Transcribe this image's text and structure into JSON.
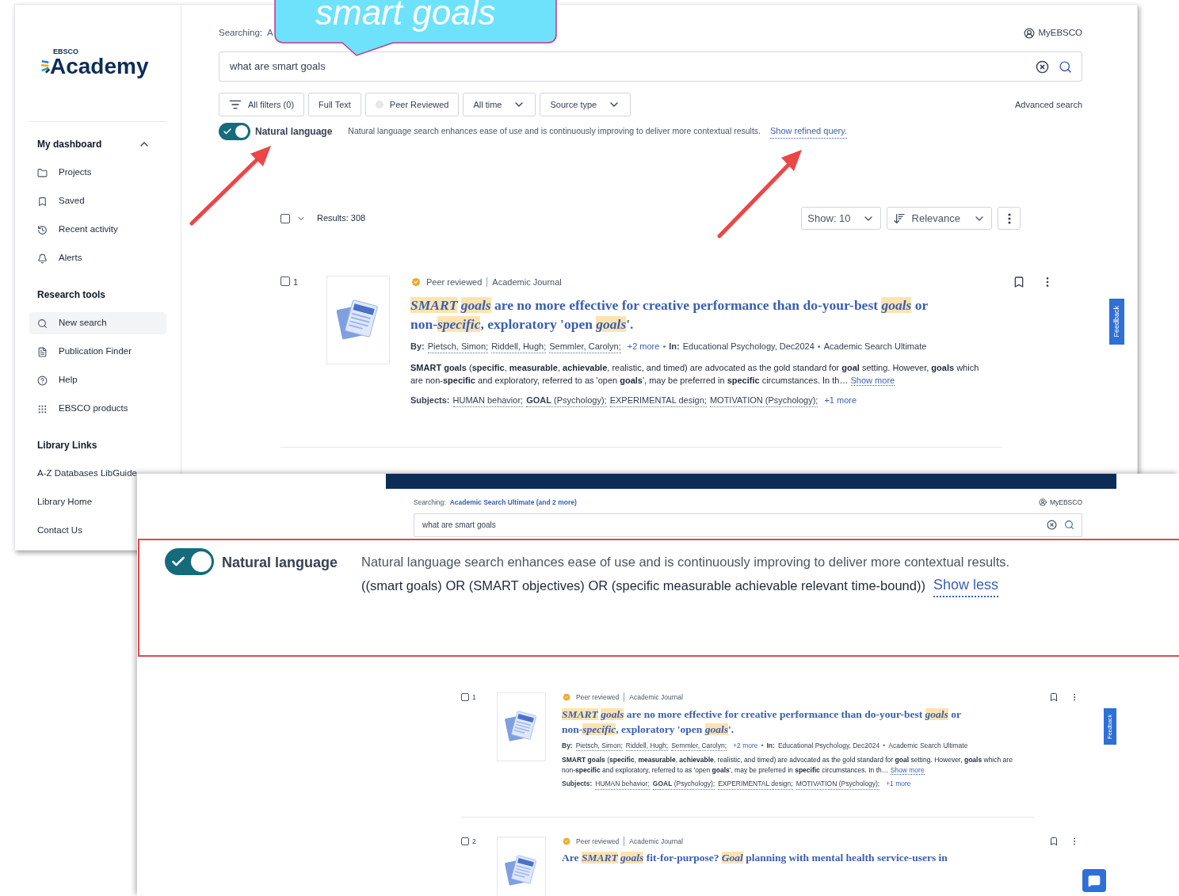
{
  "top_window": {
    "logo": {
      "brand": "EBSCO",
      "name": "Academy"
    },
    "sidebar": {
      "sections": [
        {
          "title": "My dashboard",
          "kind": "nav",
          "expanded": true,
          "items": [
            {
              "label": "Projects",
              "selected": false
            },
            {
              "label": "Saved",
              "selected": false
            },
            {
              "label": "Recent activity",
              "selected": false
            },
            {
              "label": "Alerts",
              "selected": false
            }
          ]
        },
        {
          "title": "Research tools",
          "kind": "nav",
          "items": [
            {
              "label": "New search",
              "selected": true
            },
            {
              "label": "Publication Finder",
              "selected": false
            },
            {
              "label": "Help",
              "selected": false
            },
            {
              "label": "EBSCO products",
              "selected": false
            }
          ]
        },
        {
          "title": "Library Links",
          "kind": "links",
          "items": [
            {
              "label": "A-Z Databases LibGuide",
              "selected": false
            },
            {
              "label": "Library Home",
              "selected": false
            },
            {
              "label": "Contact Us",
              "selected": false
            }
          ]
        }
      ]
    },
    "searching_label": "Searching:",
    "scope": "A",
    "account": "MyEBSCO",
    "query": "what are smart goals",
    "filters": [
      {
        "label": "All filters (0)",
        "kind": "filter"
      },
      {
        "label": "Full Text",
        "kind": "plain"
      },
      {
        "label": "Peer Reviewed",
        "kind": "check",
        "checked": false
      },
      {
        "label": "All time",
        "kind": "dropdown"
      },
      {
        "label": "Source type",
        "kind": "dropdown"
      }
    ],
    "advanced": "Advanced search",
    "natural_language": {
      "on": true,
      "label": "Natural language",
      "description": "Natural language search enhances ease of use and is continuously improving to deliver more contextual results.",
      "link": "Show refined query."
    },
    "results_bar": {
      "all_selected": false,
      "count": "Results: 308",
      "show": "Show: 10",
      "sort": "Relevance"
    },
    "results": [
      {
        "number": "1",
        "selected": false,
        "badge": "Peer reviewed",
        "type": "Academic Journal",
        "title": "*SMART* *goals* are no more effective for creative performance than do-your-best *goals* or non-*specific*, exploratory 'open *goals*'.",
        "by_label": "By:",
        "authors": [
          "Pietsch, Simon;",
          "Riddell, Hugh;",
          "Semmler, Carolyn;"
        ],
        "more_authors": "+2 more",
        "separator": "•",
        "in_label": "In:",
        "source": "Educational Psychology, Dec2024",
        "separator_2": "•",
        "database": "Academic Search Ultimate",
        "abstract": "**SMART goals** (**specific**, **measurable**, **achievable**, realistic, and timed) are advocated as the gold standard for **goal** setting. However, **goals** which are non-**specific** and exploratory, referred to as 'open **goals**', may be preferred in **specific** circumstances. In th…",
        "show_more": "Show more",
        "subjects_label": "Subjects:",
        "subjects": [
          "HUMAN behavior;",
          "**GOAL** (Psychology);",
          "EXPERIMENTAL design;",
          "MOTIVATION (Psychology);"
        ],
        "more_subjects": "+1 more"
      }
    ],
    "feedback": "Feedback"
  },
  "callout": "smart goals",
  "bottom_window": {
    "searching_label": "Searching:",
    "scope": "Academic Search Ultimate (and 2 more)",
    "account": "MyEBSCO",
    "query": "what are smart goals",
    "natural_language": {
      "on": true,
      "label": "Natural language",
      "description": "Natural language search enhances ease of use and is continuously improving to deliver more contextual results.",
      "refined_query": "((smart goals) OR (SMART objectives) OR (specific measurable achievable relevant time-bound))",
      "link": "Show less"
    },
    "results": [
      {
        "number": "1",
        "selected": false,
        "badge": "Peer reviewed",
        "type": "Academic Journal",
        "title": "*SMART* *goals* are no more effective for creative performance than do-your-best *goals* or non-*specific*, exploratory 'open *goals*'.",
        "by_label": "By:",
        "authors": [
          "Pietsch, Simon;",
          "Riddell, Hugh;",
          "Semmler, Carolyn;"
        ],
        "more_authors": "+2 more",
        "separator": "•",
        "in_label": "In:",
        "source": "Educational Psychology, Dec2024",
        "separator_2": "•",
        "database": "Academic Search Ultimate",
        "abstract": "**SMART goals** (**specific**, **measurable**, **achievable**, realistic, and timed) are advocated as the gold standard for **goal** setting. However, **goals** which are non-**specific** and exploratory, referred to as 'open **goals**', may be preferred in **specific** circumstances. In th…",
        "show_more": "Show more",
        "subjects_label": "Subjects:",
        "subjects": [
          "HUMAN behavior;",
          "**GOAL** (Psychology);",
          "EXPERIMENTAL design;",
          "MOTIVATION (Psychology);"
        ],
        "more_subjects": "+1 more"
      },
      {
        "number": "2",
        "selected": false,
        "badge": "Peer reviewed",
        "type": "Academic Journal",
        "title": "Are *SMART* *goals* fit-for-purpose? *Goal* planning with mental health service-users in"
      }
    ],
    "feedback": "Feedback"
  }
}
